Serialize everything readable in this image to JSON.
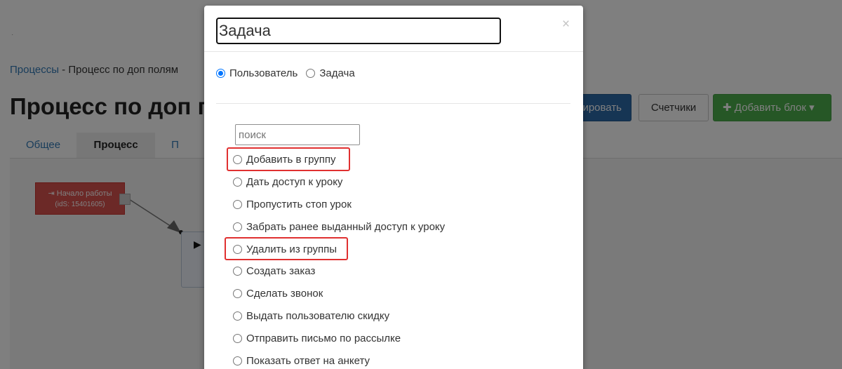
{
  "page": {
    "breadcrumb": {
      "link": "Процессы",
      "separator": " - ",
      "current": "Процесс по доп полям"
    },
    "title": "Процесс по доп полям",
    "tabs": [
      {
        "label": "Общее"
      },
      {
        "label": "Процесс"
      },
      {
        "label": "П"
      }
    ],
    "buttons": {
      "blue_label": "ировать",
      "counters_label": "Счетчики",
      "add_block_label": "✚ Добавить блок ▾"
    },
    "start_block": {
      "title": "⇥ Начало работы",
      "id_text": "(idS: 15401605)"
    },
    "dot": "·"
  },
  "modal": {
    "title_value": "Задача",
    "close_label": "×",
    "type_options": [
      {
        "label": "Пользователь",
        "checked": true
      },
      {
        "label": "Задача",
        "checked": false
      }
    ],
    "search_placeholder": "поиск",
    "actions": [
      {
        "label": "Добавить в группу",
        "highlighted": true
      },
      {
        "label": "Дать доступ к уроку",
        "highlighted": false
      },
      {
        "label": "Пропустить стоп урок",
        "highlighted": false
      },
      {
        "label": "Забрать ранее выданный доступ к уроку",
        "highlighted": false
      },
      {
        "label": "Удалить из группы",
        "highlighted": true
      },
      {
        "label": "Создать заказ",
        "highlighted": false
      },
      {
        "label": "Сделать звонок",
        "highlighted": false
      },
      {
        "label": "Выдать пользователю скидку",
        "highlighted": false
      },
      {
        "label": "Отправить письмо по рассылке",
        "highlighted": false
      },
      {
        "label": "Показать ответ на анкету",
        "highlighted": false
      }
    ]
  },
  "colors": {
    "highlight_box": "#e03030",
    "primary_blue": "#2c6aa8",
    "success_green": "#4cae4c",
    "start_block_red": "#d9534f",
    "radio_checked": "#0075ff"
  }
}
